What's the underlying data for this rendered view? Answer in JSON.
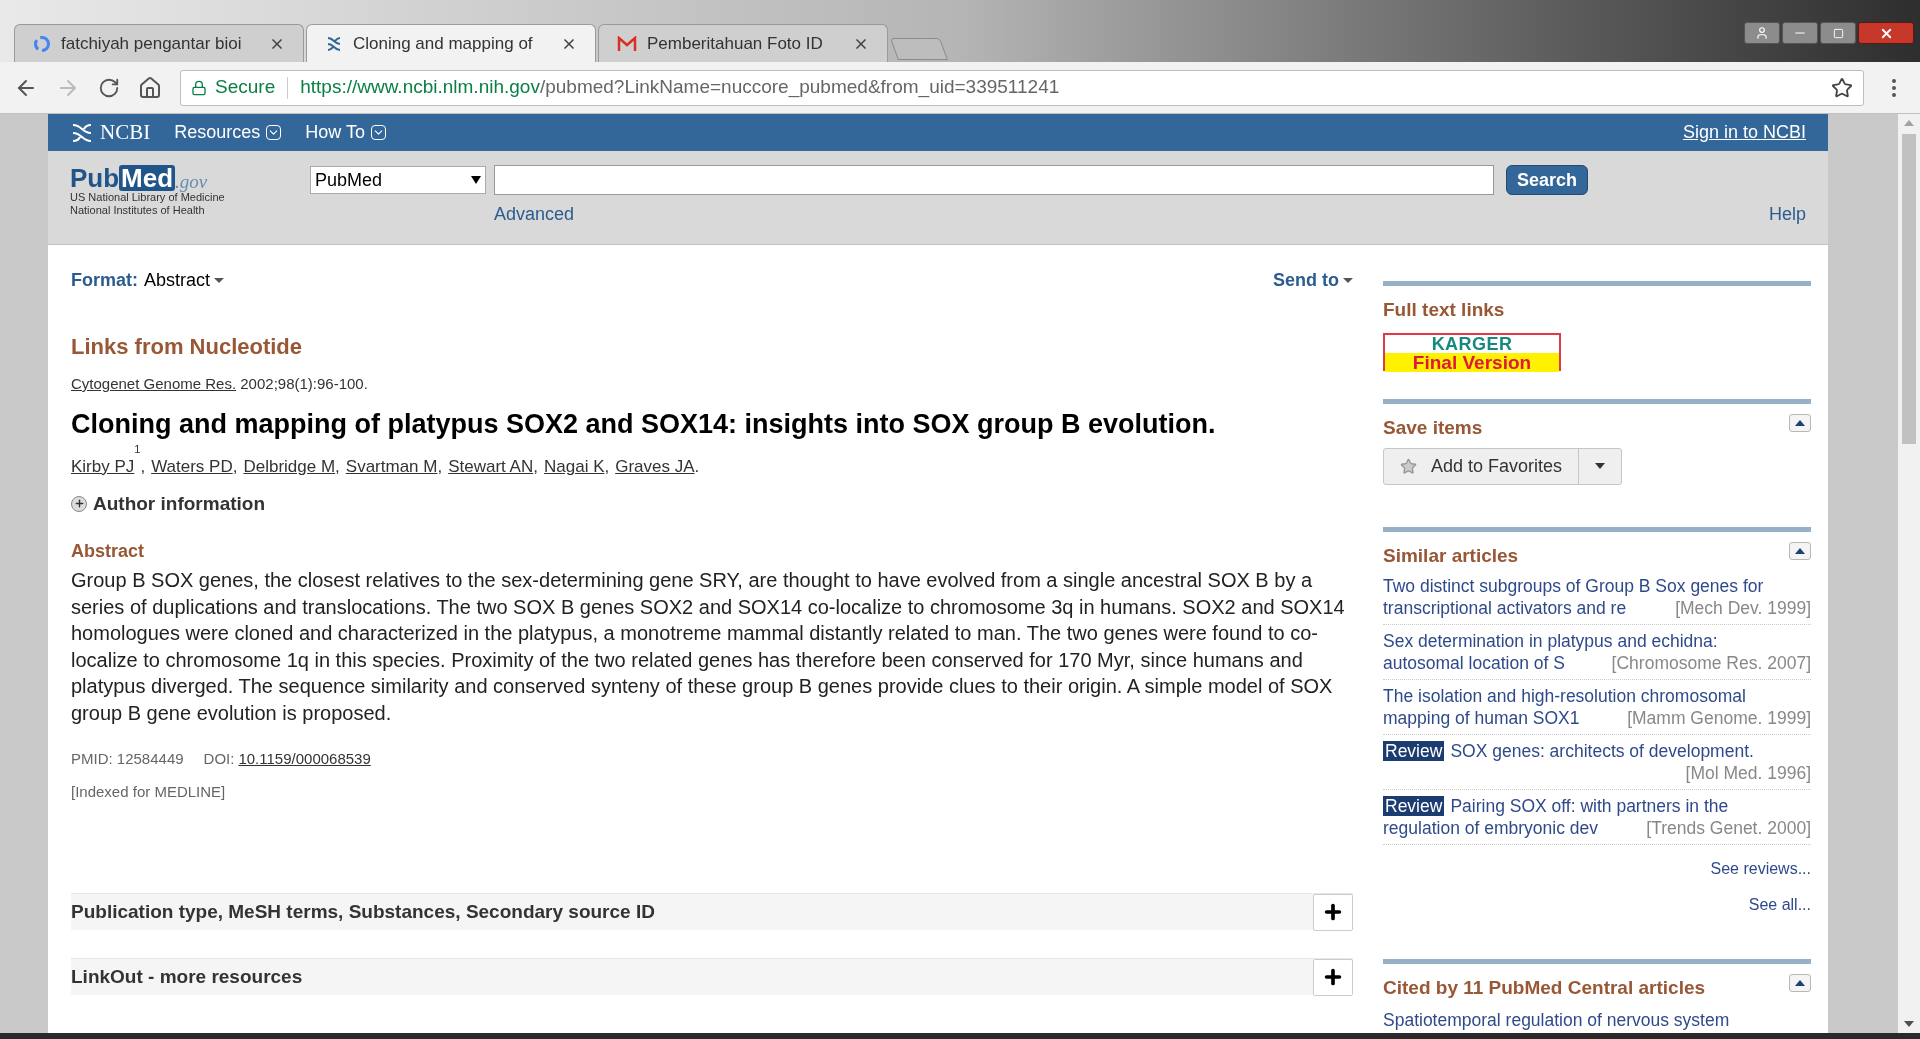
{
  "browser": {
    "tabs": [
      {
        "title": "fatchiyah pengantar bioi",
        "kind": "google",
        "selected": false
      },
      {
        "title": "Cloning and mapping of",
        "kind": "ncbi",
        "selected": true
      },
      {
        "title": "Pemberitahuan Foto ID",
        "kind": "gmail",
        "selected": false
      }
    ],
    "address": {
      "secure_label": "Secure",
      "host": "https://www.ncbi.nlm.nih.gov",
      "path": "/pubmed?LinkName=nuccore_pubmed&from_uid=339511241"
    }
  },
  "ncbi_bar": {
    "logo": "NCBI",
    "menus": [
      "Resources",
      "How To"
    ],
    "sign_in": "Sign in to NCBI"
  },
  "header": {
    "logo_parts": [
      "Pub",
      "Med",
      ".gov"
    ],
    "logo_lines": [
      "US National Library of Medicine",
      "National Institutes of Health"
    ],
    "database": "PubMed",
    "search_button": "Search",
    "advanced": "Advanced",
    "help": "Help"
  },
  "toolbar": {
    "format_label": "Format:",
    "format_value": "Abstract",
    "send_to": "Send to"
  },
  "article": {
    "section_title": "Links from Nucleotide",
    "journal": "Cytogenet Genome Res.",
    "citation": "2002;98(1):96-100.",
    "title": "Cloning and mapping of platypus SOX2 and SOX14: insights into SOX group B evolution.",
    "authors": [
      {
        "name": "Kirby PJ",
        "mark": "1",
        "separator": ","
      },
      {
        "name": "Waters PD",
        "separator": ","
      },
      {
        "name": "Delbridge M",
        "separator": ","
      },
      {
        "name": "Svartman M",
        "separator": ","
      },
      {
        "name": "Stewart AN",
        "separator": ","
      },
      {
        "name": "Nagai K",
        "separator": ","
      },
      {
        "name": "Graves JA",
        "separator": "."
      }
    ],
    "author_info": {
      "label": "Author information",
      "expanded": false
    },
    "abstract_heading": "Abstract",
    "abstract": "Group B SOX genes, the closest relatives to the sex-determining gene SRY, are thought to have evolved from a single ancestral SOX B by a series of duplications and translocations. The two SOX B genes SOX2 and SOX14 co-localize to chromosome 3q in humans. SOX2 and SOX14 homologues were cloned and characterized in the platypus, a monotreme mammal distantly related to man. The two genes were found to co-localize to chromosome 1q in this species. Proximity of the two related genes has therefore been conserved for 170 Myr, since humans and platypus diverged. The sequence similarity and conserved synteny of these group B genes provide clues to their origin. A simple model of SOX group B gene evolution is proposed.",
    "pmid": "PMID: 12584449",
    "doi_label": "DOI:",
    "doi": "10.1159/000068539",
    "indexed": "[Indexed for MEDLINE]"
  },
  "accordions": [
    {
      "title": "Publication type, MeSH terms, Substances, Secondary source ID",
      "expanded": false
    },
    {
      "title": "LinkOut - more resources",
      "expanded": false
    }
  ],
  "sidebar": {
    "full_text": {
      "heading": "Full text links",
      "logo_top": "KARGER",
      "logo_bottom": "Final Version"
    },
    "save_items": {
      "heading": "Save items",
      "expanded": true,
      "button": "Add to Favorites"
    },
    "similar": {
      "heading": "Similar articles",
      "expanded": true,
      "items": [
        {
          "lines": [
            "Two distinct subgroups of Group B Sox genes for",
            "transcriptional activators and re"
          ],
          "source": "[Mech Dev. 1999]"
        },
        {
          "lines": [
            "Sex determination in platypus and echidna:",
            "autosomal location of S"
          ],
          "source": "[Chromosome Res. 2007]"
        },
        {
          "lines": [
            "The isolation and high-resolution chromosomal",
            "mapping of human SOX1"
          ],
          "source": "[Mamm Genome. 1999]"
        },
        {
          "badge": "Review",
          "lines": [
            "SOX genes: architects of development."
          ],
          "source": "[Mol Med. 1996]"
        },
        {
          "badge": "Review",
          "lines": [
            "Pairing SOX off: with partners in the",
            "regulation of embryonic dev"
          ],
          "source": "[Trends Genet. 2000]"
        }
      ],
      "see_reviews": "See reviews...",
      "see_all": "See all..."
    },
    "cited": {
      "heading": "Cited by 11 PubMed Central articles",
      "expanded": true,
      "first_item": "Spatiotemporal regulation of nervous system"
    }
  }
}
